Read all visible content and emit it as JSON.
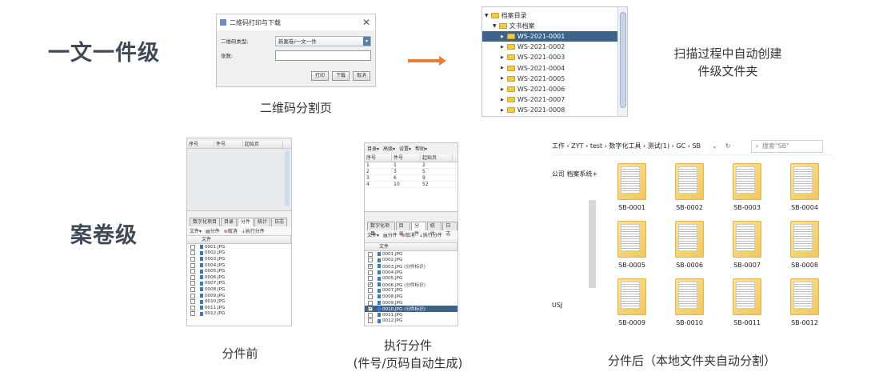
{
  "labels": {
    "piece_level": "一文一件级",
    "volume_level": "案卷级"
  },
  "captions": {
    "qr_page": "二维码分割页",
    "scan_line1": "扫描过程中自动创建",
    "scan_line2": "件级文件夹",
    "before_split": "分件前",
    "exec_split_line1": "执行分件",
    "exec_split_line2": "(件号/页码自动生成)",
    "after_split": "分件后（本地文件夹自动分割）"
  },
  "dialog": {
    "title": "二维码打印与下载",
    "type_label": "二维码类型:",
    "type_value": "新案卷/一文一件",
    "count_label": "张数:",
    "count_value": "",
    "btn_print": "打印",
    "btn_download": "下载",
    "btn_cancel": "取消"
  },
  "tree": {
    "root": "档案目录",
    "child": "文书档案",
    "items": [
      "WS-2021-0001",
      "WS-2021-0002",
      "WS-2021-0003",
      "WS-2021-0004",
      "WS-2021-0005",
      "WS-2021-0006",
      "WS-2021-0007",
      "WS-2021-0008"
    ],
    "selected_index": 0
  },
  "app": {
    "col_seq": "序号",
    "col_piece": "件号",
    "col_start": "起始页",
    "tabs": [
      "数字化项目",
      "目录",
      "分件",
      "统计",
      "日志"
    ],
    "active_tab": "分件",
    "tb_file": "文件",
    "tb_split": "分件",
    "tb_cancel": "取消",
    "tb_exec": "执行分件",
    "list_header": "文件",
    "menu_items": [
      "目录",
      "高级",
      "设置",
      "帮助"
    ]
  },
  "before_files": [
    "0001.JPG",
    "0002.JPG",
    "0003.JPG",
    "0004.JPG",
    "0005.JPG",
    "0006.JPG",
    "0007.JPG",
    "0008.JPG",
    "0009.JPG",
    "0010.JPG",
    "0011.JPG",
    "0012.JPG"
  ],
  "after_table": [
    {
      "seq": "1",
      "piece": "1",
      "start": "2"
    },
    {
      "seq": "2",
      "piece": "3",
      "start": "5"
    },
    {
      "seq": "3",
      "piece": "6",
      "start": "9"
    },
    {
      "seq": "4",
      "piece": "10",
      "start": "52"
    }
  ],
  "after_files": [
    {
      "name": "0001.JPG",
      "checked": false
    },
    {
      "name": "0002.JPG",
      "checked": false
    },
    {
      "name": "0003.JPG (分件标识)",
      "checked": true
    },
    {
      "name": "0004.JPG",
      "checked": false
    },
    {
      "name": "0005.JPG",
      "checked": false
    },
    {
      "name": "0006.JPG (分件标识)",
      "checked": true
    },
    {
      "name": "0007.JPG",
      "checked": false
    },
    {
      "name": "0008.JPG",
      "checked": false
    },
    {
      "name": "0009.JPG",
      "checked": false
    },
    {
      "name": "0010.JPG (分件标识)",
      "checked": true,
      "selected": true
    },
    {
      "name": "0011.JPG",
      "checked": false
    },
    {
      "name": "0012.JPG",
      "checked": false
    }
  ],
  "explorer": {
    "path": "工作 › ZYT › test › 数字化工具 › 测试(1) › GC › SB",
    "search_placeholder": "搜索\"SB\"",
    "side_text1": "公司 档案系统+",
    "side_text2": "USJ",
    "folders": [
      "SB-0001",
      "SB-0002",
      "SB-0003",
      "SB-0004",
      "SB-0005",
      "SB-0006",
      "SB-0007",
      "SB-0008",
      "SB-0009",
      "SB-0010",
      "SB-0011",
      "SB-0012"
    ]
  },
  "colors": {
    "arrow": "#ed7d31",
    "selection": "#3d6389",
    "label": "#404a57"
  }
}
